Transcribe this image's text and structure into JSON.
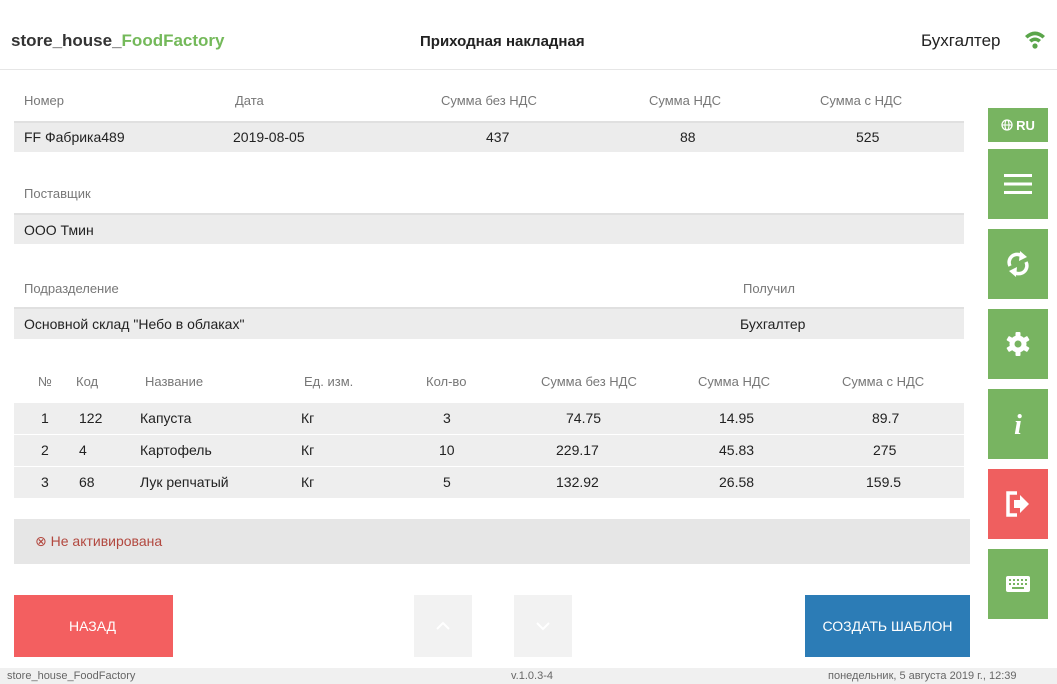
{
  "header": {
    "brand_prefix": "store_house_",
    "brand_suffix": "FoodFactory",
    "title": "Приходная накладная",
    "user": "Бухгалтер"
  },
  "doc": {
    "labels": {
      "number": "Номер",
      "date": "Дата",
      "sum_no_vat": "Сумма без НДС",
      "vat": "Сумма НДС",
      "sum_with_vat": "Сумма с НДС"
    },
    "number": "FF Фабрика489",
    "date": "2019-08-05",
    "sum_no_vat": "437",
    "vat": "88",
    "sum_with_vat": "525",
    "supplier_label": "Поставщик",
    "supplier": "ООО Тмин",
    "division_label": "Подразделение",
    "division": "Основной склад \"Небо в облаках\"",
    "received_label": "Получил",
    "received": "Бухгалтер"
  },
  "table": {
    "headers": [
      "№",
      "Код",
      "Название",
      "Ед. изм.",
      "Кол-во",
      "Сумма без НДС",
      "Сумма НДС",
      "Сумма с НДС"
    ],
    "rows": [
      [
        "1",
        "122",
        "Капуста",
        "Кг",
        "3",
        "74.75",
        "14.95",
        "89.7"
      ],
      [
        "2",
        "4",
        "Картофель",
        "Кг",
        "10",
        "229.17",
        "45.83",
        "275"
      ],
      [
        "3",
        "68",
        "Лук репчатый",
        "Кг",
        "5",
        "132.92",
        "26.58",
        "159.5"
      ]
    ]
  },
  "status": {
    "text": "⊗ Не активирована"
  },
  "buttons": {
    "back": "НАЗАД",
    "create_template": "СОЗДАТЬ ШАБЛОН"
  },
  "sidebar": {
    "lang": "RU"
  },
  "footer": {
    "app": "store_house_FoodFactory",
    "version": "v.1.0.3-4",
    "datetime": "понедельник, 5 августа 2019 г., 12:39"
  },
  "colors": {
    "accent_green": "#78b461",
    "danger": "#ef5f5f",
    "primary_blue": "#2c7cb6",
    "status_text": "#b2483f"
  }
}
